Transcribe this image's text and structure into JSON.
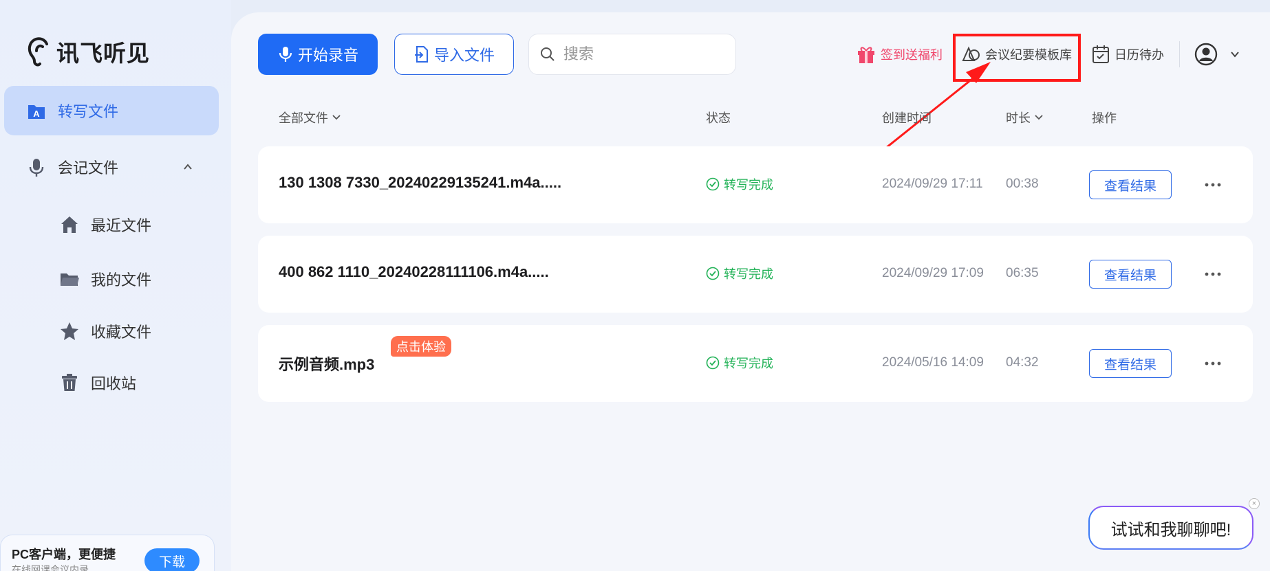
{
  "app": {
    "name": "讯飞听见"
  },
  "sidebar": {
    "transcribe_label": "转写文件",
    "meeting_label": "会记文件",
    "sub_items": [
      {
        "label": "最近文件",
        "icon": "home-icon"
      },
      {
        "label": "我的文件",
        "icon": "folder-icon"
      },
      {
        "label": "收藏文件",
        "icon": "star-icon"
      },
      {
        "label": "回收站",
        "icon": "trash-icon"
      }
    ],
    "promo": {
      "title": "PC客户端，更便捷",
      "subtitle": "在线网课会议内录",
      "button": "下载"
    }
  },
  "toolbar": {
    "record_label": "开始录音",
    "import_label": "导入文件",
    "search_placeholder": "搜索",
    "gift_label": "签到送福利",
    "template_label": "会议纪要模板库",
    "calendar_label": "日历待办"
  },
  "table": {
    "headers": {
      "all_files": "全部文件",
      "status": "状态",
      "created": "创建时间",
      "duration": "时长",
      "actions": "操作"
    },
    "rows": [
      {
        "name": "130 1308 7330_20240229135241.m4a.....",
        "status": "转写完成",
        "created": "2024/09/29 17:11",
        "duration": "00:38",
        "action": "查看结果"
      },
      {
        "name": "400 862 1110_20240228111106.m4a.....",
        "status": "转写完成",
        "created": "2024/09/29 17:09",
        "duration": "06:35",
        "action": "查看结果"
      },
      {
        "name": "示例音频.mp3",
        "status": "转写完成",
        "created": "2024/05/16 14:09",
        "duration": "04:32",
        "action": "查看结果",
        "badge": "点击体验"
      }
    ]
  },
  "chat": {
    "text": "试试和我聊聊吧!",
    "close": "×"
  },
  "colors": {
    "primary": "#1f6bf5",
    "accent_link": "#2f6ae6",
    "success": "#22b257",
    "gift": "#f0476c",
    "badge": "#ff6f4e",
    "annotation": "#ff1a1a"
  }
}
